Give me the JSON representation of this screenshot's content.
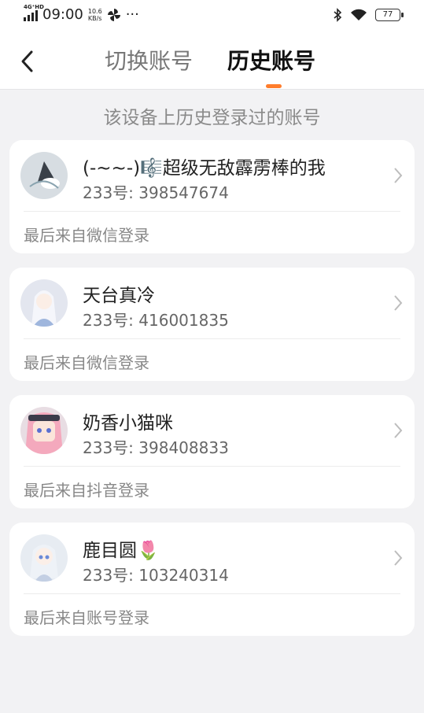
{
  "status_bar": {
    "network": "4G⁺HD",
    "time": "09:00",
    "speed_value": "10.6",
    "speed_unit": "KB/s",
    "more": "···",
    "battery": "77"
  },
  "header": {
    "tabs": [
      {
        "label": "切换账号",
        "active": false
      },
      {
        "label": "历史账号",
        "active": true
      }
    ],
    "accent_color": "#ff7d2c"
  },
  "subtitle": "该设备上历史登录过的账号",
  "accounts": [
    {
      "name": "(-~~-)🎼超级无敌霹雳棒的我",
      "uid": "233号: 398547674",
      "last_login": "最后来自微信登录"
    },
    {
      "name": "天台真冷",
      "uid": "233号: 416001835",
      "last_login": "最后来自微信登录"
    },
    {
      "name": "奶香小猫咪",
      "uid": "233号: 398408833",
      "last_login": "最后来自抖音登录"
    },
    {
      "name": "鹿目圆🌷",
      "uid": "233号: 103240314",
      "last_login": "最后来自账号登录"
    }
  ]
}
